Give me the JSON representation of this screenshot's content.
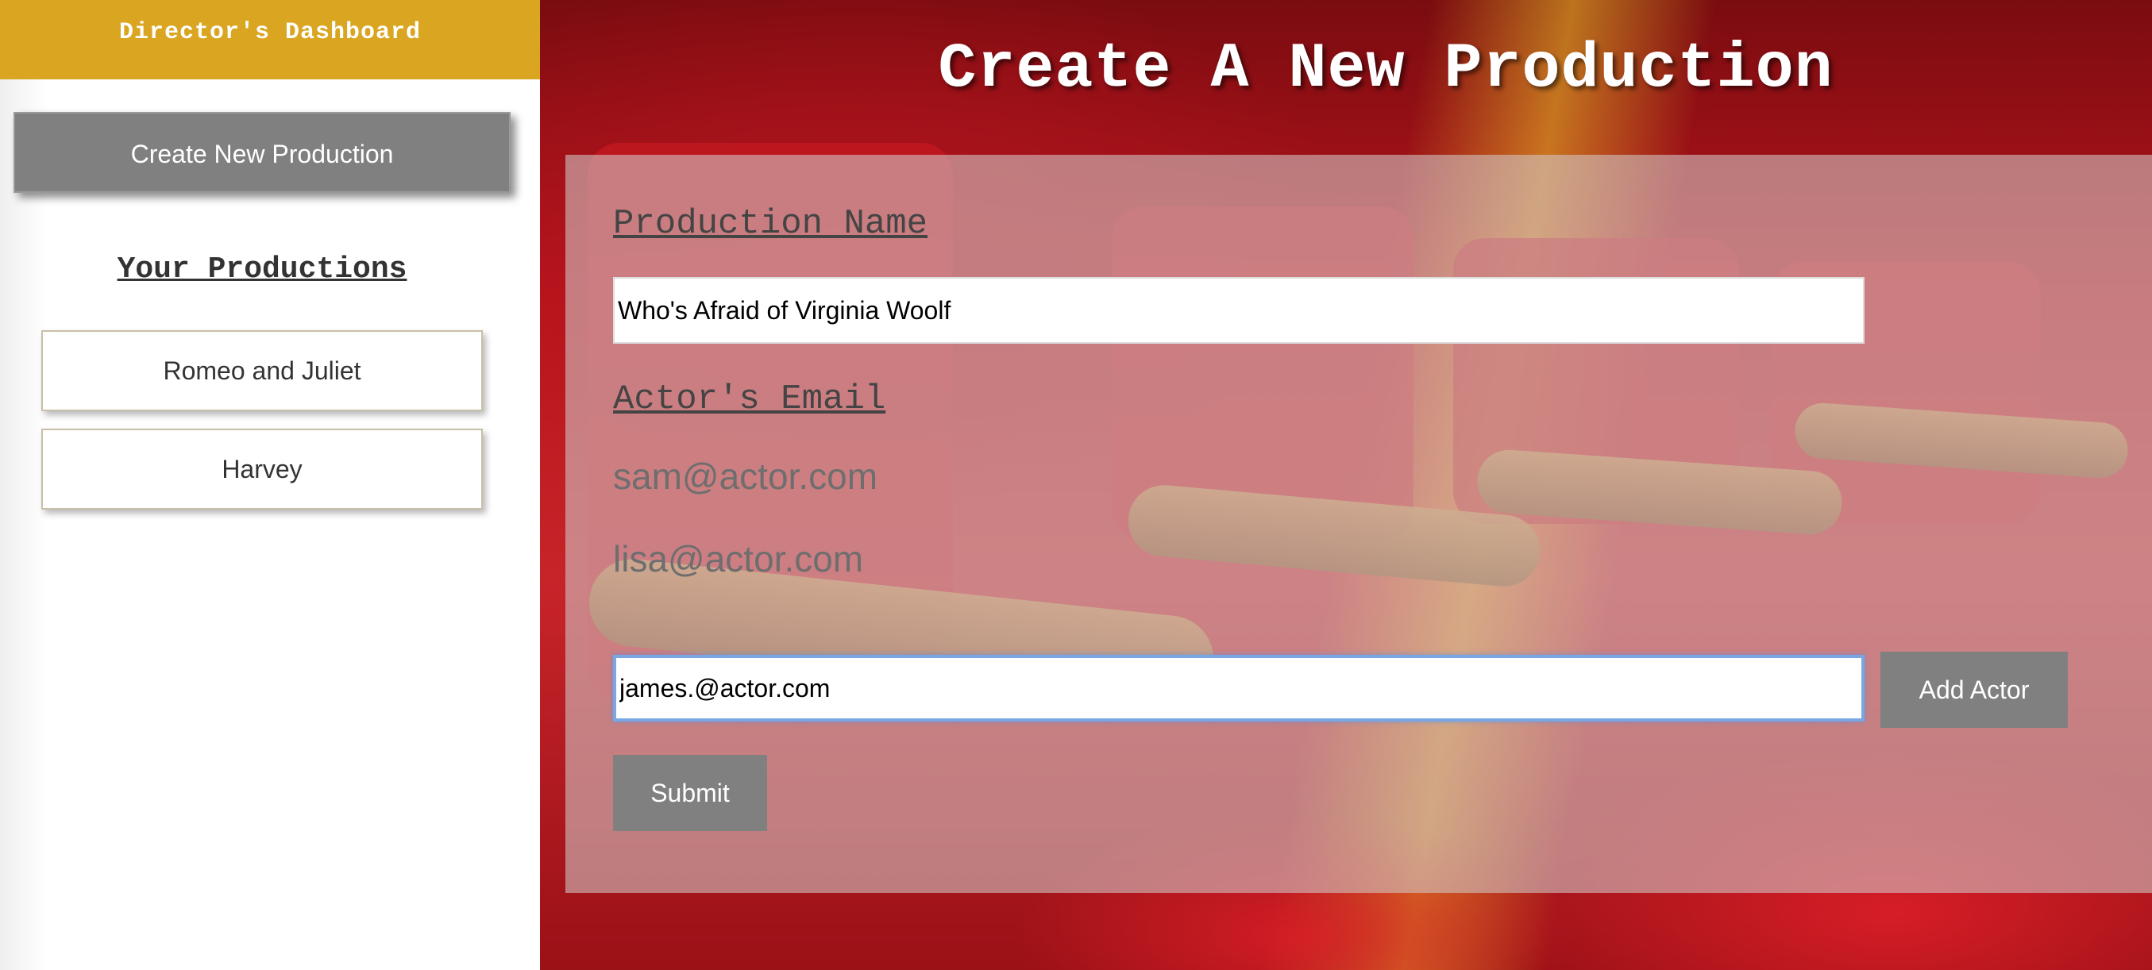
{
  "sidebar": {
    "header_title": "Director's Dashboard",
    "create_button_label": "Create New Production",
    "productions_heading": "Your Productions",
    "productions": [
      {
        "label": "Romeo and Juliet"
      },
      {
        "label": "Harvey"
      }
    ]
  },
  "main": {
    "title": "Create A New Production",
    "production_name_label": "Production Name",
    "production_name_value": "Who's Afraid of Virginia Woolf",
    "actor_email_label": "Actor's Email",
    "actor_emails": [
      "sam@actor.com",
      "lisa@actor.com"
    ],
    "actor_email_input_value": "james.@actor.com",
    "add_actor_label": "Add Actor",
    "submit_label": "Submit"
  },
  "colors": {
    "header_gold": "#daa520",
    "button_gray": "#808080",
    "focus_blue": "#7aa7e3"
  }
}
